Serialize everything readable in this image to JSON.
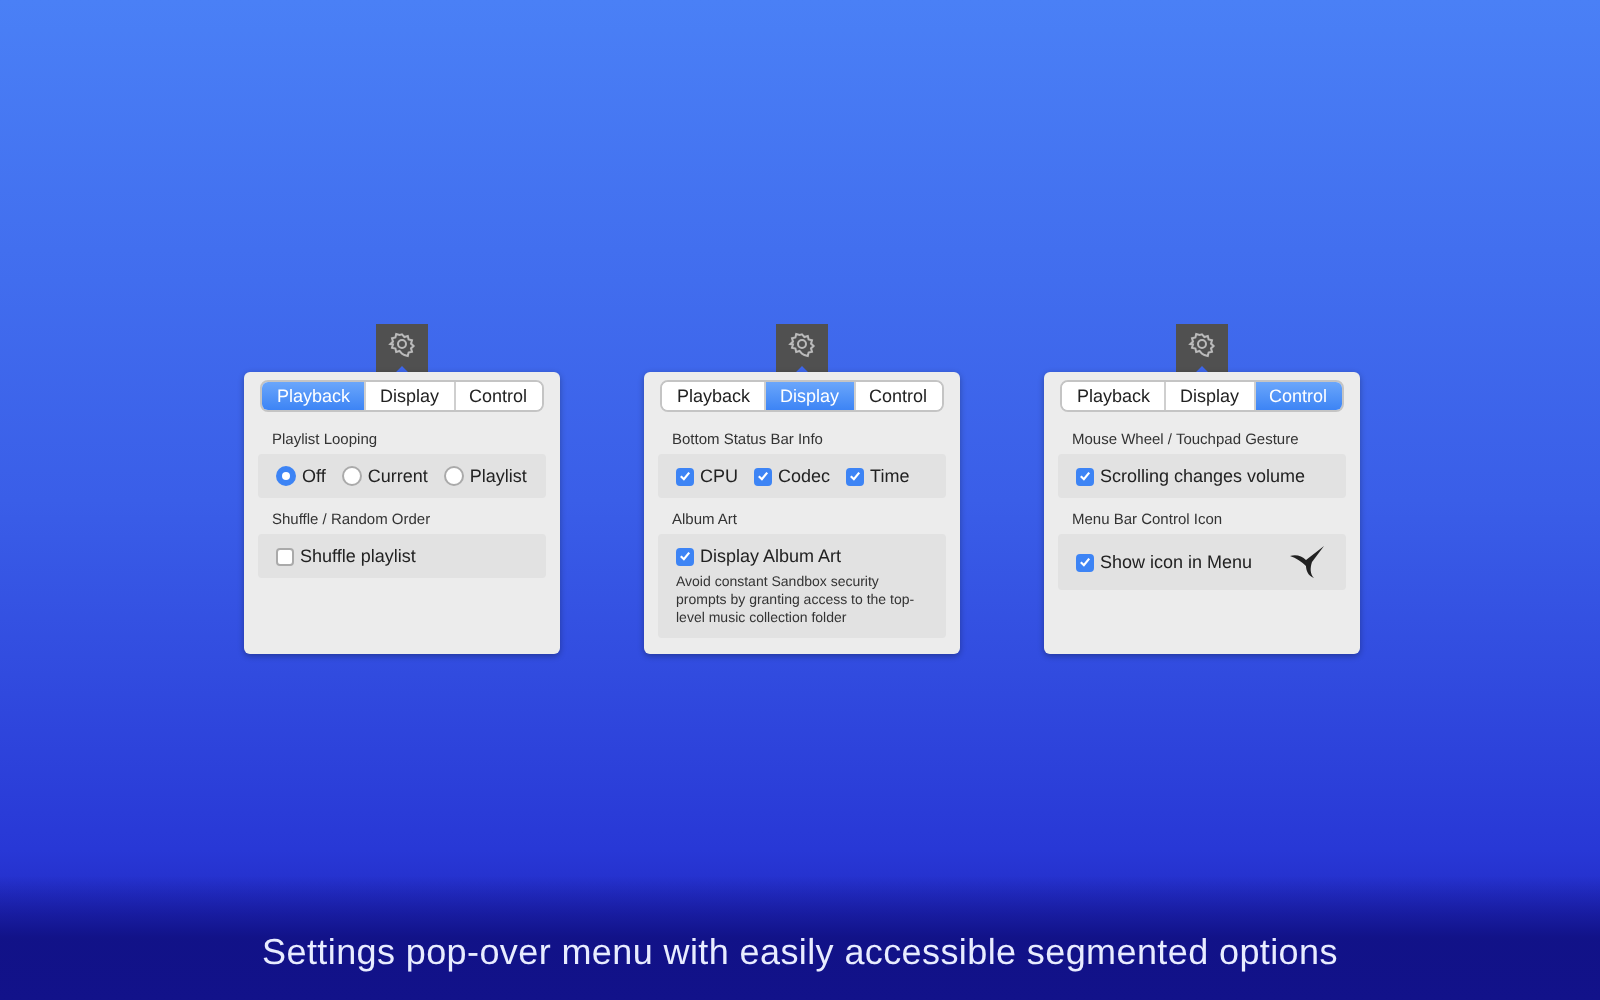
{
  "panels": [
    {
      "tabs": [
        {
          "label": "Playback",
          "selected": true
        },
        {
          "label": "Display",
          "selected": false
        },
        {
          "label": "Control",
          "selected": false
        }
      ],
      "sections": [
        {
          "title": "Playlist Looping",
          "kind": "radio",
          "items": [
            {
              "label": "Off",
              "selected": true
            },
            {
              "label": "Current",
              "selected": false
            },
            {
              "label": "Playlist",
              "selected": false
            }
          ]
        },
        {
          "title": "Shuffle / Random Order",
          "kind": "check",
          "items": [
            {
              "label": "Shuffle playlist",
              "checked": false
            }
          ]
        }
      ]
    },
    {
      "tabs": [
        {
          "label": "Playback",
          "selected": false
        },
        {
          "label": "Display",
          "selected": true
        },
        {
          "label": "Control",
          "selected": false
        }
      ],
      "sections": [
        {
          "title": "Bottom Status Bar Info",
          "kind": "check",
          "items": [
            {
              "label": "CPU",
              "checked": true
            },
            {
              "label": "Codec",
              "checked": true
            },
            {
              "label": "Time",
              "checked": true
            }
          ]
        },
        {
          "title": "Album Art",
          "kind": "check",
          "items": [
            {
              "label": "Display Album Art",
              "checked": true
            }
          ],
          "note": "Avoid constant Sandbox security prompts by granting access to the top-level music collection folder"
        }
      ]
    },
    {
      "tabs": [
        {
          "label": "Playback",
          "selected": false
        },
        {
          "label": "Display",
          "selected": false
        },
        {
          "label": "Control",
          "selected": true
        }
      ],
      "sections": [
        {
          "title": "Mouse Wheel / Touchpad Gesture",
          "kind": "check",
          "items": [
            {
              "label": "Scrolling changes volume",
              "checked": true
            }
          ]
        },
        {
          "title": "Menu Bar Control Icon",
          "kind": "check-icon",
          "items": [
            {
              "label": "Show icon in Menu",
              "checked": true
            }
          ]
        }
      ]
    }
  ],
  "caption": "Settings pop-over menu with easily accessible segmented options"
}
